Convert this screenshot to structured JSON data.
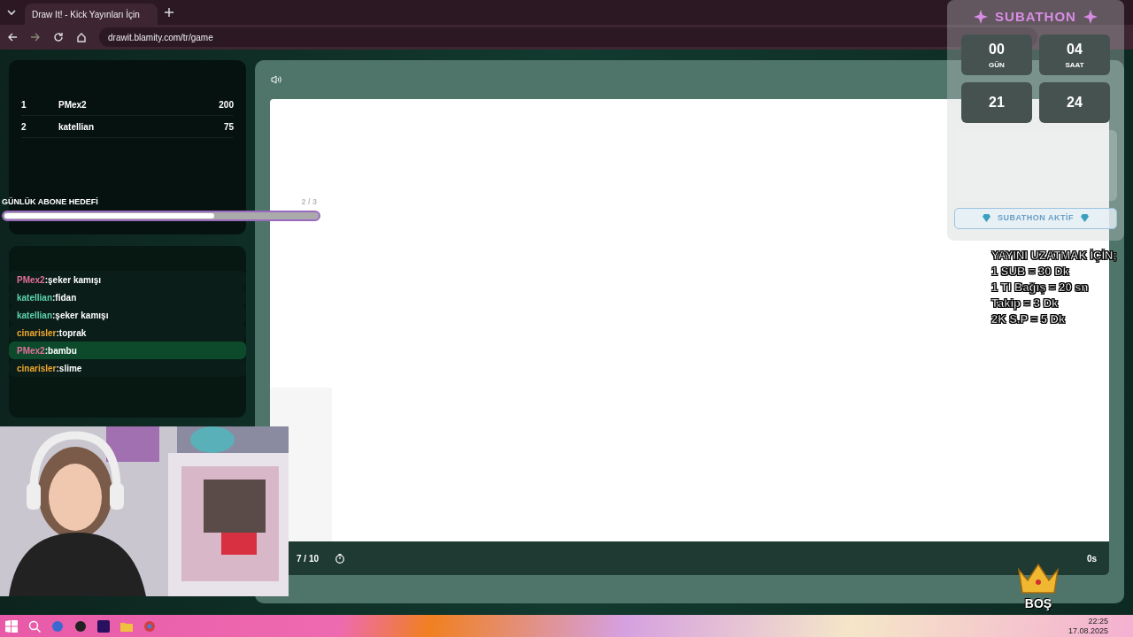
{
  "browser": {
    "tab_title": "Draw It! - Kick Yayınları İçin",
    "url": "drawit.blamity.com/tr/game"
  },
  "leaderboard": [
    {
      "rank": "1",
      "name": "PMex2",
      "score": "200"
    },
    {
      "rank": "2",
      "name": "katellian",
      "score": "75"
    }
  ],
  "goal": {
    "label": "GÜNLÜK ABONE HEDEFİ",
    "count": "2 / 3",
    "level": 0.67
  },
  "chat": [
    {
      "name": "PMex2",
      "color": "#e0709a",
      "message": ":şeker kamışı",
      "selected": false
    },
    {
      "name": "katellian",
      "color": "#5fd3b0",
      "message": ":fidan",
      "selected": false
    },
    {
      "name": "katellian",
      "color": "#5fd3b0",
      "message": ":şeker kamışı",
      "selected": false
    },
    {
      "name": "cinarisler",
      "color": "#f0a830",
      "message": ":toprak",
      "selected": false
    },
    {
      "name": "PMex2",
      "color": "#e0709a",
      "message": ":bambu",
      "selected": true
    },
    {
      "name": "cinarisler",
      "color": "#f0a830",
      "message": ":slime",
      "selected": false
    }
  ],
  "game": {
    "round": "7 / 10",
    "time": "0s"
  },
  "subathon": {
    "title": "SUBATHON",
    "timers": [
      {
        "value": "00",
        "unit": "GÜN"
      },
      {
        "value": "04",
        "unit": "SAAT"
      },
      {
        "value": "21"
      },
      {
        "value": "24"
      }
    ],
    "status": "SUBATHON AKTİF"
  },
  "rules": [
    "YAYINI UZATMAK İÇİN;",
    "1 SUB = 30 Dk",
    "1 Tl Bağış = 20 sn",
    "Takip = 3 Dk",
    "2K S.P = 5 Dk"
  ],
  "crown_label": "BOŞ",
  "taskbar": {
    "time": "22:25",
    "date": "17.08.2025"
  }
}
